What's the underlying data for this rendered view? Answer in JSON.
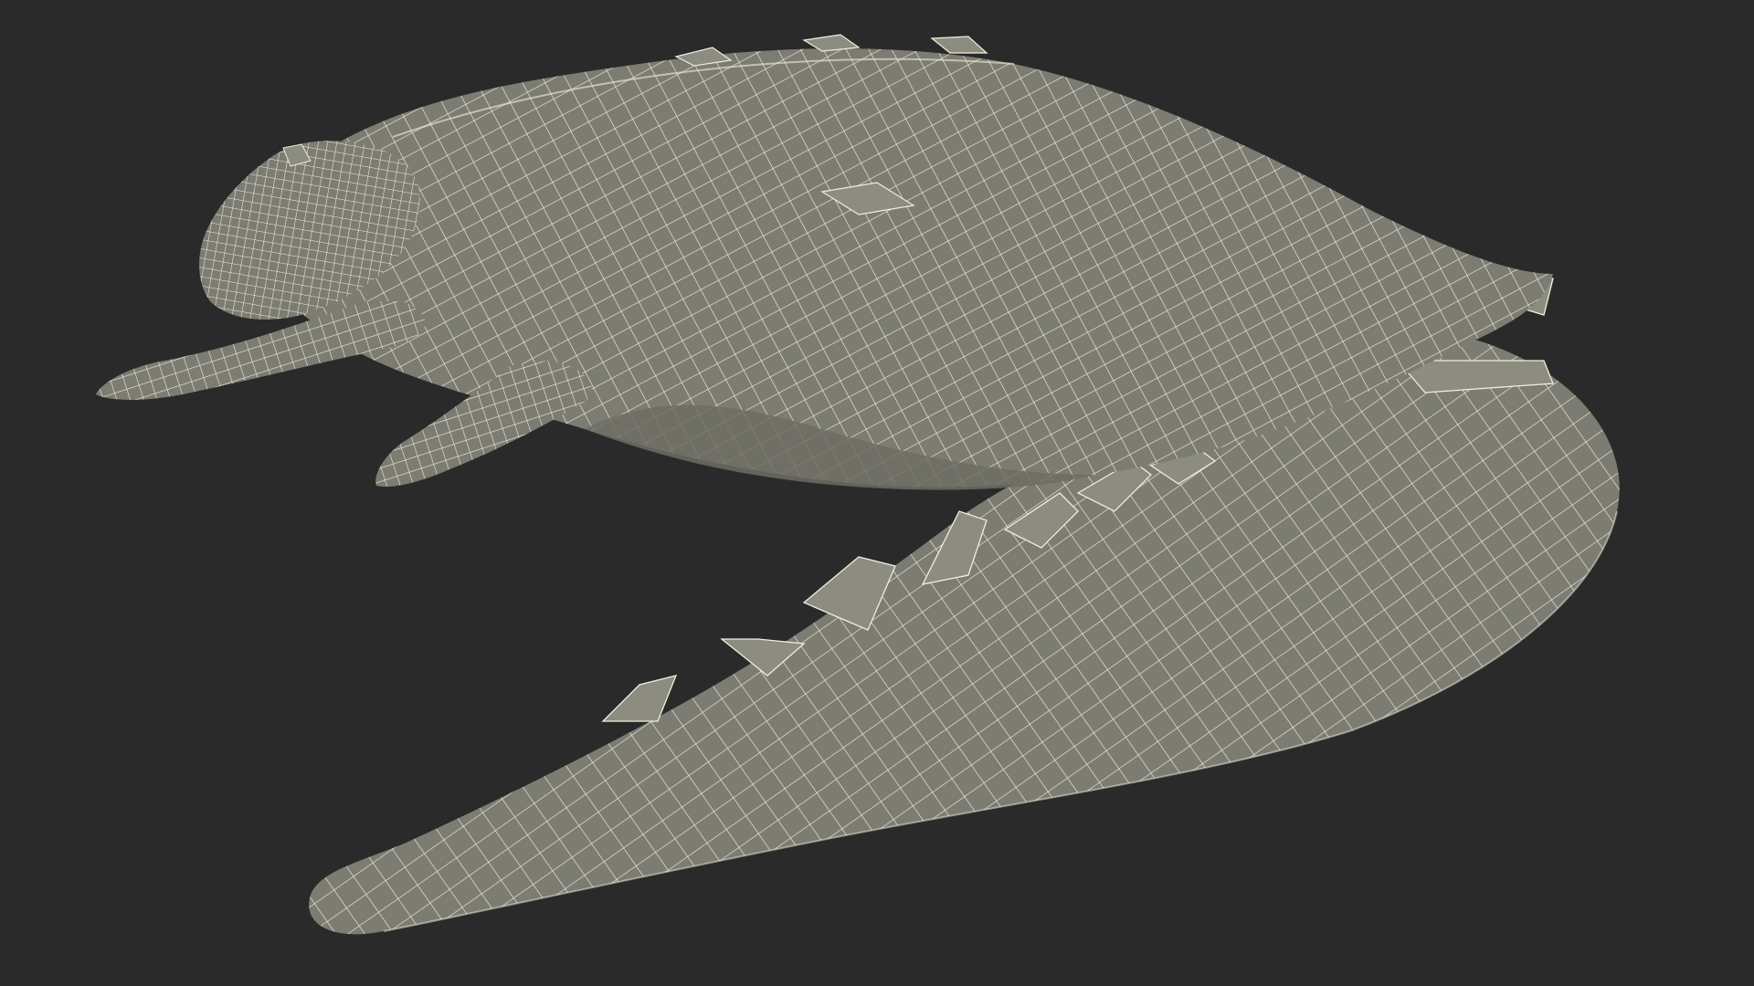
{
  "scene": {
    "subject": "crocodile-wireframe-mesh",
    "colors": {
      "background": "#2a2a2a",
      "mesh_fill": "#7c7c72",
      "mesh_fill_shadow": "#6d6d64",
      "mesh_fill_light": "#8a8a7f",
      "wire": "#f0eedc",
      "spike_fill": "#8c8c81"
    }
  }
}
